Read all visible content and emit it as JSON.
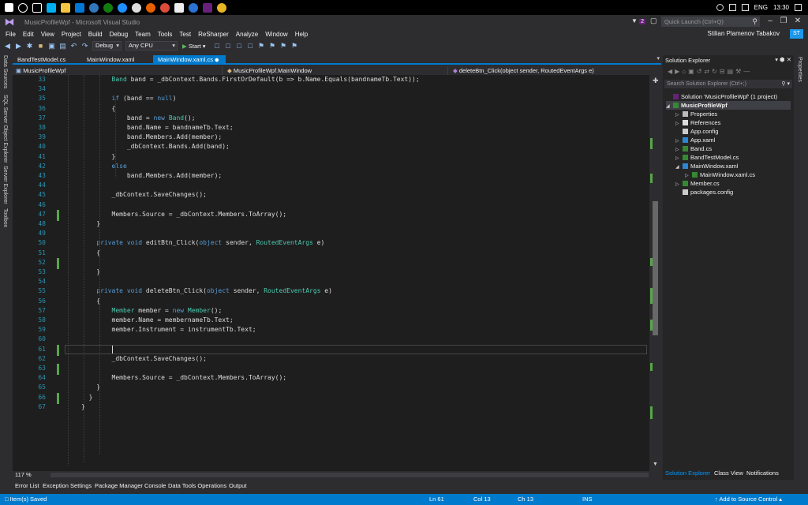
{
  "window": {
    "title": "MusicProfileWpf - Microsoft Visual Studio",
    "notification_count": "2",
    "quick_launch_placeholder": "Quick Launch (Ctrl+Q)",
    "user_name": "Stilian Plamenov Tabakov",
    "user_initials": "ST"
  },
  "taskbar": {
    "language": "ENG",
    "time": "13:30"
  },
  "menu": [
    "File",
    "Edit",
    "View",
    "Project",
    "Build",
    "Debug",
    "Team",
    "Tools",
    "Test",
    "ReSharper",
    "Analyze",
    "Window",
    "Help"
  ],
  "toolbar": {
    "configuration": "Debug",
    "platform": "Any CPU",
    "start_label": "Start"
  },
  "left_rail": [
    "Data Sources",
    "SQL Server Object Explorer",
    "Server Explorer",
    "Toolbox"
  ],
  "doc_tabs": [
    {
      "label": "BandTestModel.cs",
      "active": false
    },
    {
      "label": "MainWindow.xaml",
      "active": false
    },
    {
      "label": "MainWindow.xaml.cs",
      "active": true
    }
  ],
  "nav": {
    "project": "MusicProfileWpf",
    "type": "MusicProfileWpf.MainWindow",
    "member": "deleteBtn_Click(object sender, RoutedEventArgs e)"
  },
  "code": [
    {
      "n": "33",
      "t": "Band band = _dbContext.Bands.FirstOrDefault(b => b.Name.Equals(bandnameTb.Text));"
    },
    {
      "n": "34",
      "t": ""
    },
    {
      "n": "35",
      "t": "if (band == null)"
    },
    {
      "n": "36",
      "t": "{"
    },
    {
      "n": "37",
      "t": "band = new Band();"
    },
    {
      "n": "38",
      "t": "band.Name = bandnameTb.Text;"
    },
    {
      "n": "39",
      "t": "band.Members.Add(member);"
    },
    {
      "n": "40",
      "t": "_dbContext.Bands.Add(band);"
    },
    {
      "n": "41",
      "t": "}"
    },
    {
      "n": "42",
      "t": "else"
    },
    {
      "n": "43",
      "t": "band.Members.Add(member);"
    },
    {
      "n": "44",
      "t": ""
    },
    {
      "n": "45",
      "t": "_dbContext.SaveChanges();"
    },
    {
      "n": "46",
      "t": ""
    },
    {
      "n": "47",
      "t": "Members.Source = _dbContext.Members.ToArray();"
    },
    {
      "n": "48",
      "t": "}"
    },
    {
      "n": "49",
      "t": ""
    },
    {
      "n": "50",
      "t": "private void editBtn_Click(object sender, RoutedEventArgs e)"
    },
    {
      "n": "51",
      "t": "{"
    },
    {
      "n": "52",
      "t": ""
    },
    {
      "n": "53",
      "t": "}"
    },
    {
      "n": "54",
      "t": ""
    },
    {
      "n": "55",
      "t": "private void deleteBtn_Click(object sender, RoutedEventArgs e)"
    },
    {
      "n": "56",
      "t": "{"
    },
    {
      "n": "57",
      "t": "Member member = new Member();"
    },
    {
      "n": "58",
      "t": "member.Name = membernameTb.Text;"
    },
    {
      "n": "59",
      "t": "member.Instrument = instrumentTb.Text;"
    },
    {
      "n": "60",
      "t": ""
    },
    {
      "n": "61",
      "t": ""
    },
    {
      "n": "62",
      "t": "_dbContext.SaveChanges();"
    },
    {
      "n": "63",
      "t": ""
    },
    {
      "n": "64",
      "t": "Members.Source = _dbContext.Members.ToArray();"
    },
    {
      "n": "65",
      "t": "}"
    },
    {
      "n": "66",
      "t": "}"
    },
    {
      "n": "67",
      "t": "}"
    }
  ],
  "zoom": "117 %",
  "bottom_tabs": [
    "Error List",
    "Exception Settings",
    "Package Manager Console",
    "Data Tools Operations",
    "Output"
  ],
  "status": {
    "message": "Item(s) Saved",
    "line": "Ln 61",
    "col": "Col 13",
    "ch": "Ch 13",
    "mode": "INS",
    "source_control": "Add to Source Control"
  },
  "solution_explorer": {
    "title": "Solution Explorer",
    "search_placeholder": "Search Solution Explorer (Ctrl+;)",
    "nodes": [
      "Solution 'MusicProfileWpf' (1 project)",
      "MusicProfileWpf",
      "Properties",
      "References",
      "App.config",
      "App.xaml",
      "Band.cs",
      "BandTestModel.cs",
      "MainWindow.xaml",
      "MainWindow.xaml.cs",
      "Member.cs",
      "packages.config"
    ],
    "bottom_tabs": [
      "Solution Explorer",
      "Class View",
      "Notifications"
    ]
  },
  "right_rail": [
    "Properties"
  ],
  "colors": {
    "accent": "#007acc",
    "keyword": "#569cd6",
    "type": "#4ec9b0",
    "line_number": "#2b91af",
    "change_green": "#57a64a"
  }
}
